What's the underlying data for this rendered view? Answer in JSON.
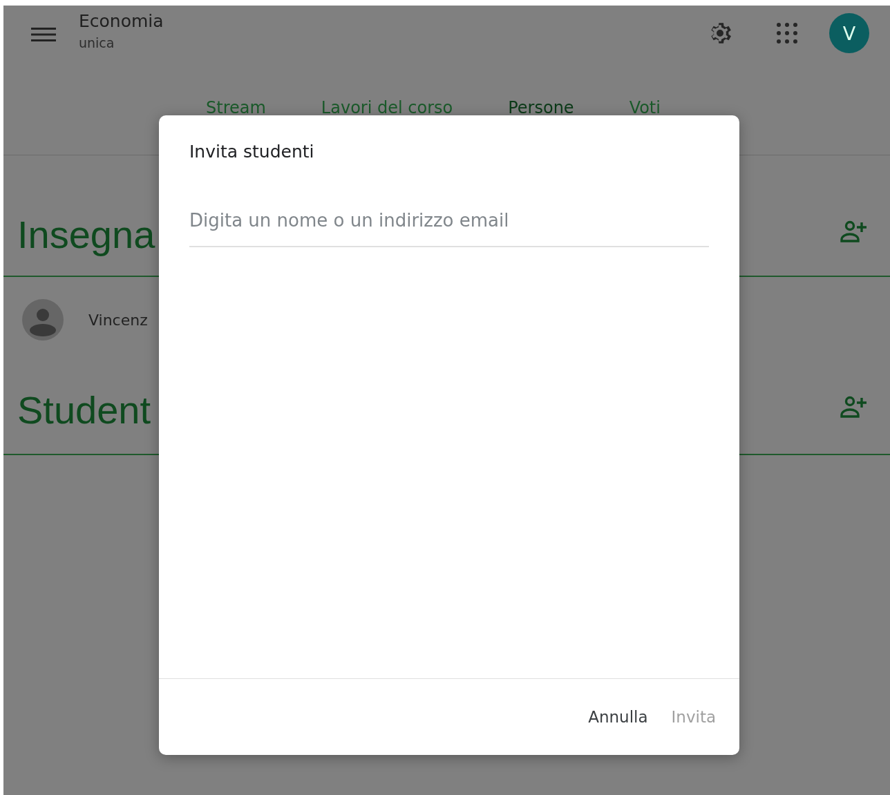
{
  "header": {
    "title": "Economia",
    "subtitle": "unica",
    "avatar_letter": "V"
  },
  "tabs": [
    {
      "label": "Stream",
      "selected": false
    },
    {
      "label": "Lavori del corso",
      "selected": false
    },
    {
      "label": "Persone",
      "selected": true
    },
    {
      "label": "Voti",
      "selected": false
    }
  ],
  "sections": [
    {
      "heading": "Insegna",
      "people": [
        {
          "name": "Vincenz"
        }
      ]
    },
    {
      "heading": "Student"
    }
  ],
  "dialog": {
    "title": "Invita studenti",
    "placeholder": "Digita un nome o un indirizzo email",
    "buttons": [
      {
        "label": "Annulla",
        "disabled": false
      },
      {
        "label": "Invita",
        "disabled": true
      }
    ]
  }
}
